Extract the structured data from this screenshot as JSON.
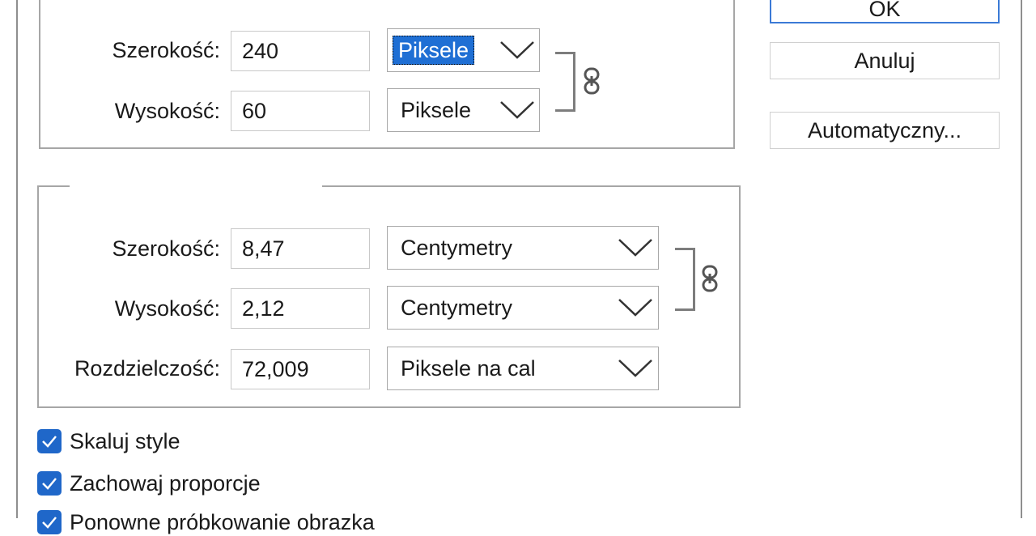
{
  "colors": {
    "accent": "#1f67c9",
    "selection": "#1f6fd4",
    "ok_border": "#3b7ad6"
  },
  "pixel_dimensions": {
    "width": {
      "label": "Szerokość:",
      "value": "240",
      "unit": "Piksele",
      "unit_selected": true
    },
    "height": {
      "label": "Wysokość:",
      "value": "60",
      "unit": "Piksele"
    },
    "link_icon": "chain-link-icon"
  },
  "document_size": {
    "width": {
      "label": "Szerokość:",
      "value": "8,47",
      "unit": "Centymetry"
    },
    "height": {
      "label": "Wysokość:",
      "value": "2,12",
      "unit": "Centymetry"
    },
    "resolution": {
      "label": "Rozdzielczość:",
      "value": "72,009",
      "unit": "Piksele na cal"
    },
    "link_icon": "chain-link-icon"
  },
  "buttons": {
    "ok": "OK",
    "cancel": "Anuluj",
    "auto": "Automatyczny..."
  },
  "checkboxes": [
    {
      "label": "Skaluj style",
      "checked": true
    },
    {
      "label": "Zachowaj proporcje",
      "checked": true
    },
    {
      "label": "Ponowne próbkowanie obrazka",
      "checked": true
    }
  ]
}
